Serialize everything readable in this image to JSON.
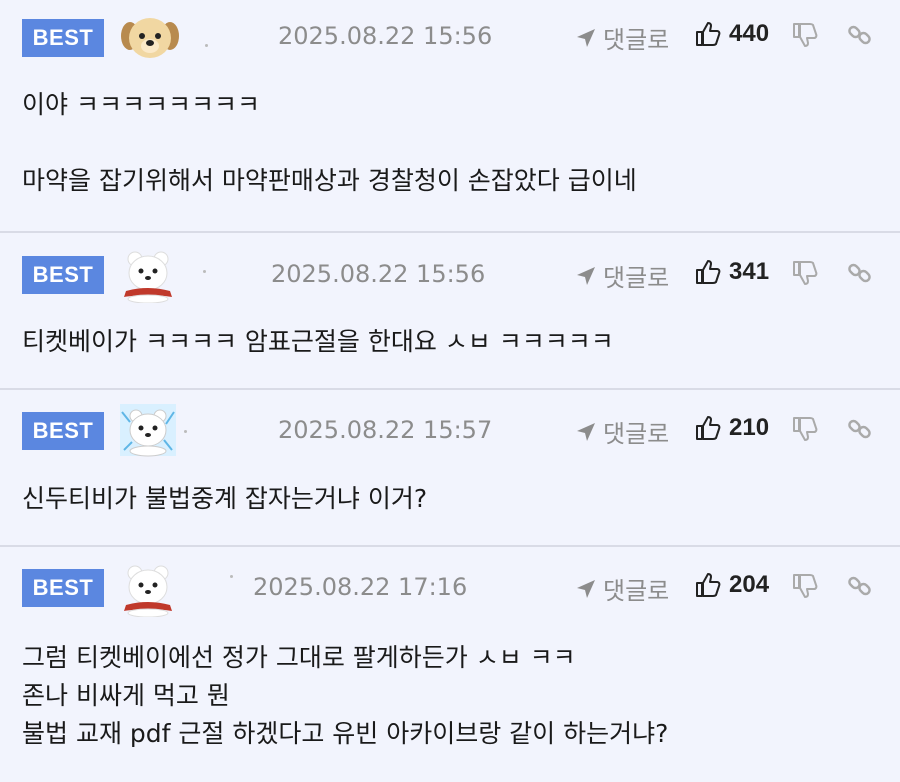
{
  "colors": {
    "badge": "#5b87e0",
    "background": "#f2f4fd",
    "meta": "#8c8c8c"
  },
  "comments": [
    {
      "badge": "BEST",
      "avatar": "puppy-avatar",
      "date": "2025.08.22 15:56",
      "reply_label": "댓글로",
      "likes": "440",
      "lines": [
        "이야 ㅋㅋㅋㅋㅋㅋㅋㅋ",
        "",
        "마약을 잡기위해서 마약판매상과 경찰청이 손잡았다 급이네"
      ]
    },
    {
      "badge": "BEST",
      "avatar": "polar-bear-avatar",
      "date": "2025.08.22 15:56",
      "reply_label": "댓글로",
      "likes": "341",
      "lines": [
        "티켓베이가 ㅋㅋㅋㅋ 암표근절을 한대요 ㅅㅂ ㅋㅋㅋㅋㅋ"
      ]
    },
    {
      "badge": "BEST",
      "avatar": "polar-bear-sparkle-avatar",
      "date": "2025.08.22 15:57",
      "reply_label": "댓글로",
      "likes": "210",
      "lines": [
        "신두티비가 불법중계 잡자는거냐 이거?"
      ]
    },
    {
      "badge": "BEST",
      "avatar": "polar-bear-avatar",
      "date": "2025.08.22 17:16",
      "reply_label": "댓글로",
      "likes": "204",
      "lines": [
        "그럼 티켓베이에선 정가 그대로 팔게하든가 ㅅㅂ ㅋㅋ",
        "존나 비싸게 먹고 뭔",
        "불법 교재 pdf 근절 하겠다고 유빈 아카이브랑 같이 하는거냐?"
      ]
    }
  ]
}
